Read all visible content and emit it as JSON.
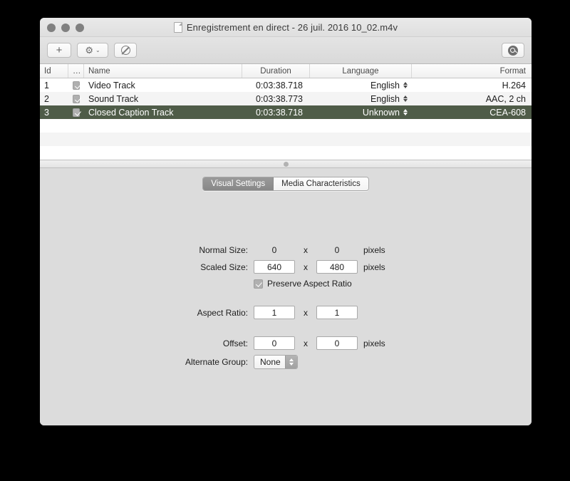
{
  "window": {
    "title": "Enregistrement en direct - 26 juil. 2016 10_02.m4v",
    "doc_icon": "document-icon",
    "traffic_lights": [
      "close",
      "minimize",
      "maximize"
    ]
  },
  "toolbar": {
    "add_label": "+",
    "gear_label": "⚙",
    "gear_chevron": "⌄",
    "disable_icon": "prohibited-icon",
    "search_icon": "search-icon"
  },
  "table": {
    "columns": [
      "Id",
      "…",
      "Name",
      "Duration",
      "Language",
      "Format"
    ],
    "rows": [
      {
        "id": "1",
        "checked": true,
        "name": "Video Track",
        "duration": "0:03:38.718",
        "language": "English",
        "format": "H.264",
        "selected": false
      },
      {
        "id": "2",
        "checked": true,
        "name": "Sound Track",
        "duration": "0:03:38.773",
        "language": "English",
        "format": "AAC, 2 ch",
        "selected": false
      },
      {
        "id": "3",
        "checked": true,
        "name": "Closed Caption Track",
        "duration": "0:03:38.718",
        "language": "Unknown",
        "format": "CEA-608",
        "selected": true
      }
    ],
    "selected_row_color": "#4f5c48",
    "empty_row_count": 3
  },
  "splitter": {
    "grip": "resize-grip-dot"
  },
  "tabs": [
    {
      "label": "Visual Settings",
      "active": true
    },
    {
      "label": "Media Characteristics",
      "active": false
    }
  ],
  "form": {
    "normal_size": {
      "label": "Normal Size:",
      "width": "0",
      "x": "x",
      "height": "0",
      "unit": "pixels"
    },
    "scaled_size": {
      "label": "Scaled Size:",
      "width": "640",
      "x": "x",
      "height": "480",
      "unit": "pixels"
    },
    "preserve_aspect_ratio": {
      "label": "Preserve Aspect Ratio",
      "checked": true
    },
    "aspect_ratio": {
      "label": "Aspect Ratio:",
      "width": "1",
      "x": "x",
      "height": "1",
      "unit": ""
    },
    "offset": {
      "label": "Offset:",
      "width": "0",
      "x": "x",
      "height": "0",
      "unit": "pixels"
    },
    "alternate_group": {
      "label": "Alternate Group:",
      "value": "None"
    }
  }
}
